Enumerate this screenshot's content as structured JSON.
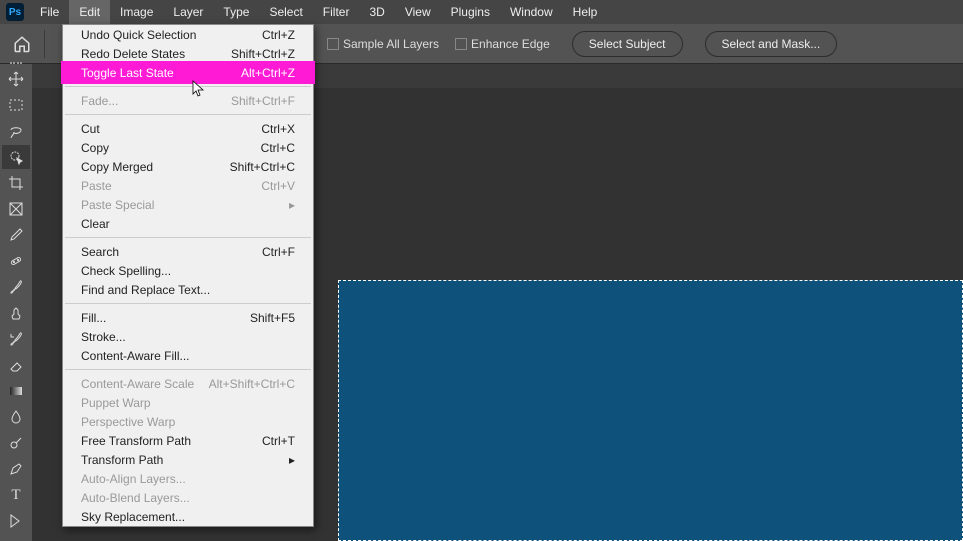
{
  "app_logo": "Ps",
  "menu": [
    "File",
    "Edit",
    "Image",
    "Layer",
    "Type",
    "Select",
    "Filter",
    "3D",
    "View",
    "Plugins",
    "Window",
    "Help"
  ],
  "options": {
    "sample_all": "Sample All Layers",
    "enhance_edge": "Enhance Edge",
    "select_subject": "Select Subject",
    "select_and_mask": "Select and Mask..."
  },
  "edit_menu": [
    {
      "label": "Undo Quick Selection",
      "shortcut": "Ctrl+Z"
    },
    {
      "label": "Redo Delete States",
      "shortcut": "Shift+Ctrl+Z"
    },
    {
      "label": "Toggle Last State",
      "shortcut": "Alt+Ctrl+Z",
      "highlight": true
    },
    {
      "sep": true
    },
    {
      "label": "Fade...",
      "shortcut": "Shift+Ctrl+F",
      "disabled": true
    },
    {
      "sep": true
    },
    {
      "label": "Cut",
      "shortcut": "Ctrl+X"
    },
    {
      "label": "Copy",
      "shortcut": "Ctrl+C"
    },
    {
      "label": "Copy Merged",
      "shortcut": "Shift+Ctrl+C"
    },
    {
      "label": "Paste",
      "shortcut": "Ctrl+V",
      "disabled": true
    },
    {
      "label": "Paste Special",
      "submenu": true,
      "disabled": true
    },
    {
      "label": "Clear"
    },
    {
      "sep": true
    },
    {
      "label": "Search",
      "shortcut": "Ctrl+F"
    },
    {
      "label": "Check Spelling..."
    },
    {
      "label": "Find and Replace Text..."
    },
    {
      "sep": true
    },
    {
      "label": "Fill...",
      "shortcut": "Shift+F5"
    },
    {
      "label": "Stroke..."
    },
    {
      "label": "Content-Aware Fill..."
    },
    {
      "sep": true
    },
    {
      "label": "Content-Aware Scale",
      "shortcut": "Alt+Shift+Ctrl+C",
      "disabled": true
    },
    {
      "label": "Puppet Warp",
      "disabled": true
    },
    {
      "label": "Perspective Warp",
      "disabled": true
    },
    {
      "label": "Free Transform Path",
      "shortcut": "Ctrl+T"
    },
    {
      "label": "Transform Path",
      "submenu": true
    },
    {
      "label": "Auto-Align Layers...",
      "disabled": true
    },
    {
      "label": "Auto-Blend Layers...",
      "disabled": true
    },
    {
      "label": "Sky Replacement..."
    }
  ],
  "tools": [
    "move",
    "marquee",
    "lasso",
    "quick-select",
    "crop",
    "frame",
    "eyedropper",
    "heal",
    "brush",
    "clone",
    "history-brush",
    "eraser",
    "gradient",
    "blur",
    "dodge",
    "pen",
    "type",
    "path"
  ],
  "colors": {
    "accent": "#ff1bd6",
    "canvas": "#0e517a"
  }
}
